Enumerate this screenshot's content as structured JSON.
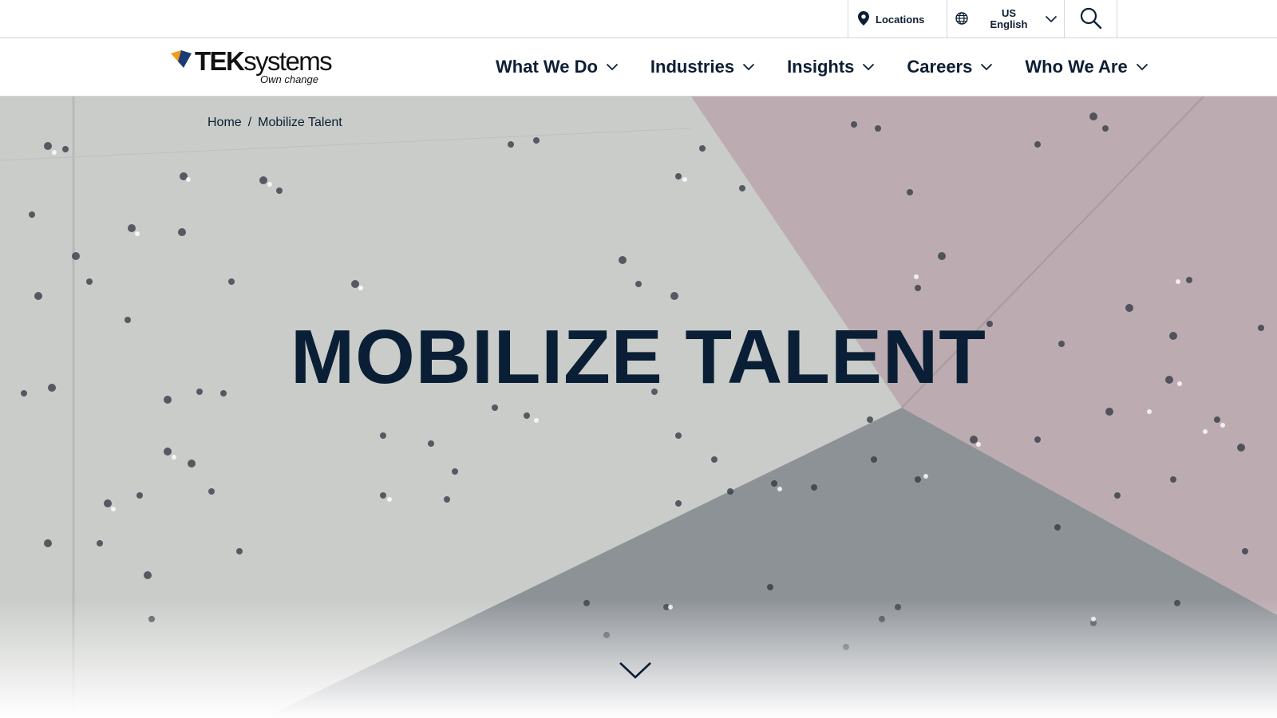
{
  "utility_bar": {
    "locations_label": "Locations",
    "language": {
      "region": "US",
      "language": "English"
    },
    "icons": {
      "locations": "map-pin-icon",
      "language": "globe-icon",
      "language_chevron": "chevron-down-icon",
      "search": "search-icon"
    }
  },
  "header": {
    "logo": {
      "brand_bold": "TEK",
      "brand_light": "systems",
      "tagline": "Own change",
      "accent_color": "#f39a1e",
      "mark_color": "#1b3b73"
    },
    "nav": [
      {
        "label": "What We Do"
      },
      {
        "label": "Industries"
      },
      {
        "label": "Insights"
      },
      {
        "label": "Careers"
      },
      {
        "label": "Who We Are"
      }
    ]
  },
  "hero": {
    "breadcrumb": {
      "home": "Home",
      "separator": "/",
      "current": "Mobilize Talent"
    },
    "title": "MOBILIZE TALENT",
    "scroll_icon": "chevron-down-icon"
  },
  "colors": {
    "text_primary": "#0c1e33",
    "border": "#d5d7da",
    "hero_gray": "#c7cac6",
    "hero_pink": "#bba9ad",
    "hero_dark": "#8b9095"
  }
}
